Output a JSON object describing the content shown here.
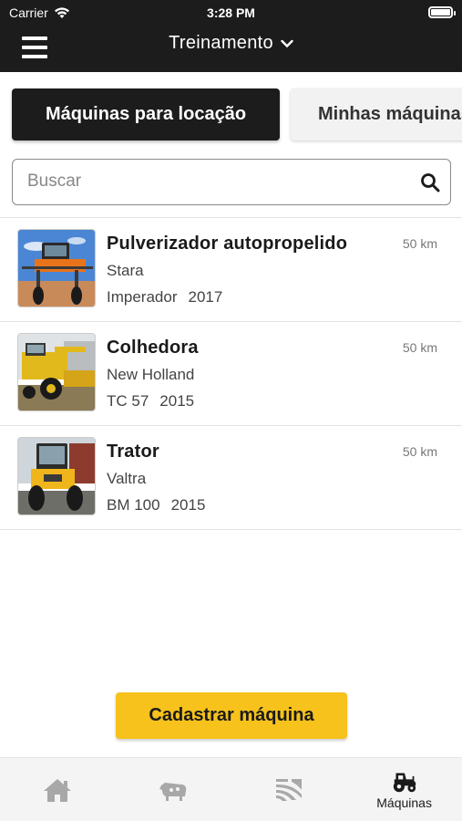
{
  "status": {
    "carrier": "Carrier",
    "time": "3:28 PM"
  },
  "header": {
    "title": "Treinamento"
  },
  "tabs": [
    {
      "label": "Máquinas para locação",
      "active": true
    },
    {
      "label": "Minhas máquinas",
      "active": false
    }
  ],
  "search": {
    "placeholder": "Buscar",
    "value": ""
  },
  "machines": [
    {
      "title": "Pulverizador autopropelido",
      "brand": "Stara",
      "model": "Imperador",
      "year": "2017",
      "distance": "50 km",
      "image": "sprayer"
    },
    {
      "title": "Colhedora",
      "brand": "New Holland",
      "model": "TC 57",
      "year": "2015",
      "distance": "50 km",
      "image": "harvester"
    },
    {
      "title": "Trator",
      "brand": "Valtra",
      "model": "BM 100",
      "year": "2015",
      "distance": "50 km",
      "image": "tractor"
    }
  ],
  "cta": {
    "label": "Cadastrar máquina"
  },
  "bottom_nav": {
    "items": [
      {
        "icon": "home-icon",
        "label": ""
      },
      {
        "icon": "cattle-icon",
        "label": ""
      },
      {
        "icon": "field-icon",
        "label": ""
      },
      {
        "icon": "tractor-icon",
        "label": "Máquinas",
        "active": true
      }
    ]
  },
  "colors": {
    "header_bg": "#1c1c1c",
    "accent": "#f6c21b",
    "inactive_icon": "#a8a8a8"
  }
}
